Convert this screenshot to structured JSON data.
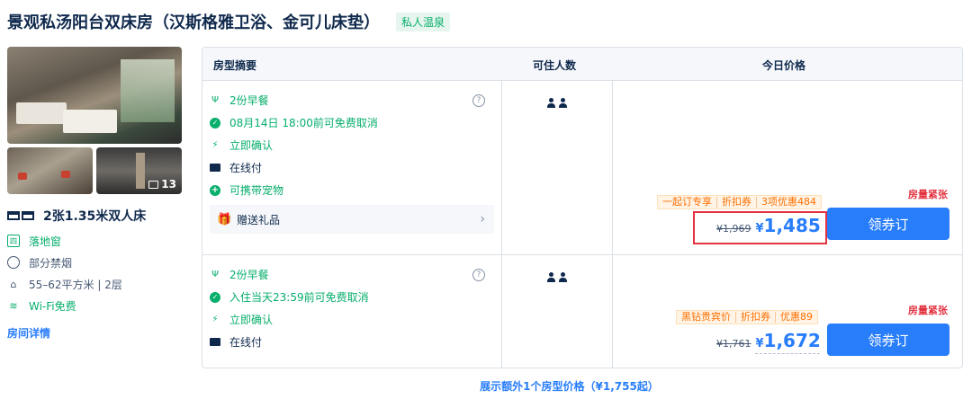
{
  "room": {
    "title": "景观私汤阳台双床房（汉斯格雅卫浴、金可儿床垫）",
    "tag": "私人温泉",
    "photo_count": "13",
    "bed": "2张1.35米双人床",
    "features": [
      {
        "icon": "window-icon",
        "label": "落地窗"
      },
      {
        "icon": "no-smoking-icon",
        "label": "部分禁烟"
      },
      {
        "icon": "area-icon",
        "label": "55–62平方米 | 2层"
      },
      {
        "icon": "wifi-icon",
        "label": "Wi-Fi免费"
      }
    ],
    "detail_link": "房间详情"
  },
  "table": {
    "headers": [
      "房型摘要",
      "可住人数",
      "今日价格"
    ]
  },
  "plans": [
    {
      "breakfast": "2份早餐",
      "cancel": "08月14日 18:00前可免费取消",
      "confirm": "立即确认",
      "payment": "在线付",
      "pets": "可携带宠物",
      "gift": "赠送礼品",
      "scarce": "房量紧张",
      "promos": [
        "一起订专享",
        "折扣券",
        "3项优惠484"
      ],
      "original_price": "¥1,969",
      "price_symbol": "¥",
      "price": "1,485",
      "button": "领券订"
    },
    {
      "breakfast": "2份早餐",
      "cancel": "入住当天23:59前可免费取消",
      "confirm": "立即确认",
      "payment": "在线付",
      "scarce": "房量紧张",
      "promos": [
        "黑钻贵宾价",
        "折扣券",
        "优惠89"
      ],
      "original_price": "¥1,761",
      "price_symbol": "¥",
      "price": "1,672",
      "button": "领券订"
    }
  ],
  "more_link": "展示额外1个房型价格（¥1,755起）",
  "colors": {
    "accent": "#287dfa",
    "green": "#06ae6b",
    "alert": "#e33340",
    "promo": "#ff6f00"
  }
}
